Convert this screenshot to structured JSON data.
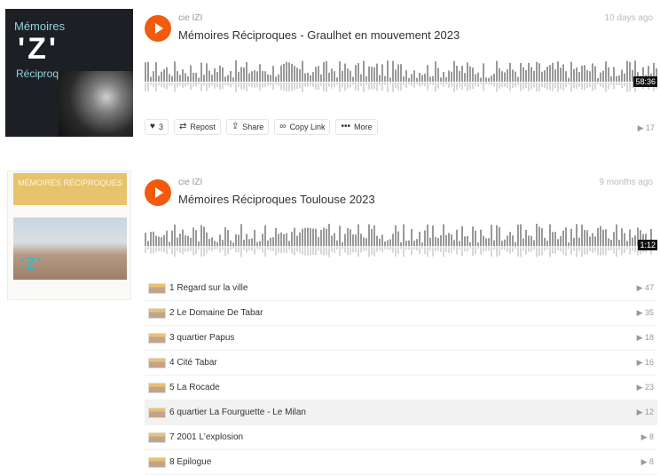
{
  "accent_color": "#f25a0f",
  "track1": {
    "art": {
      "line1": "Mémoires",
      "izi": "'Z'",
      "line2": "Réciproques"
    },
    "user": "cie IZI",
    "title": "Mémoires Réciproques - Graulhet en mouvement 2023",
    "date": "10 days ago",
    "duration": "58:36",
    "actions": {
      "like_count": "3",
      "repost": "Repost",
      "share": "Share",
      "copy_link": "Copy Link",
      "more": "More"
    },
    "plays": "17"
  },
  "track2": {
    "art": {
      "head": "MÉMOIRES RÉCIPROQUES",
      "izi": "'Z'"
    },
    "user": "cie IZI",
    "title": "Mémoires Réciproques Toulouse 2023",
    "date": "9 months ago",
    "duration": "1:12",
    "tracklist": [
      {
        "label": "1 Regard sur la ville",
        "plays": "47"
      },
      {
        "label": "2 Le Domaine De Tabar",
        "plays": "35"
      },
      {
        "label": "3 quartier Papus",
        "plays": "18"
      },
      {
        "label": "4 Cité Tabar",
        "plays": "16"
      },
      {
        "label": "5 La Rocade",
        "plays": "23"
      },
      {
        "label": "6 quartier La Fourguette - Le Milan",
        "plays": "12"
      },
      {
        "label": "7 2001 L'explosion",
        "plays": "8"
      },
      {
        "label": "8 Epilogue",
        "plays": "8"
      }
    ]
  }
}
